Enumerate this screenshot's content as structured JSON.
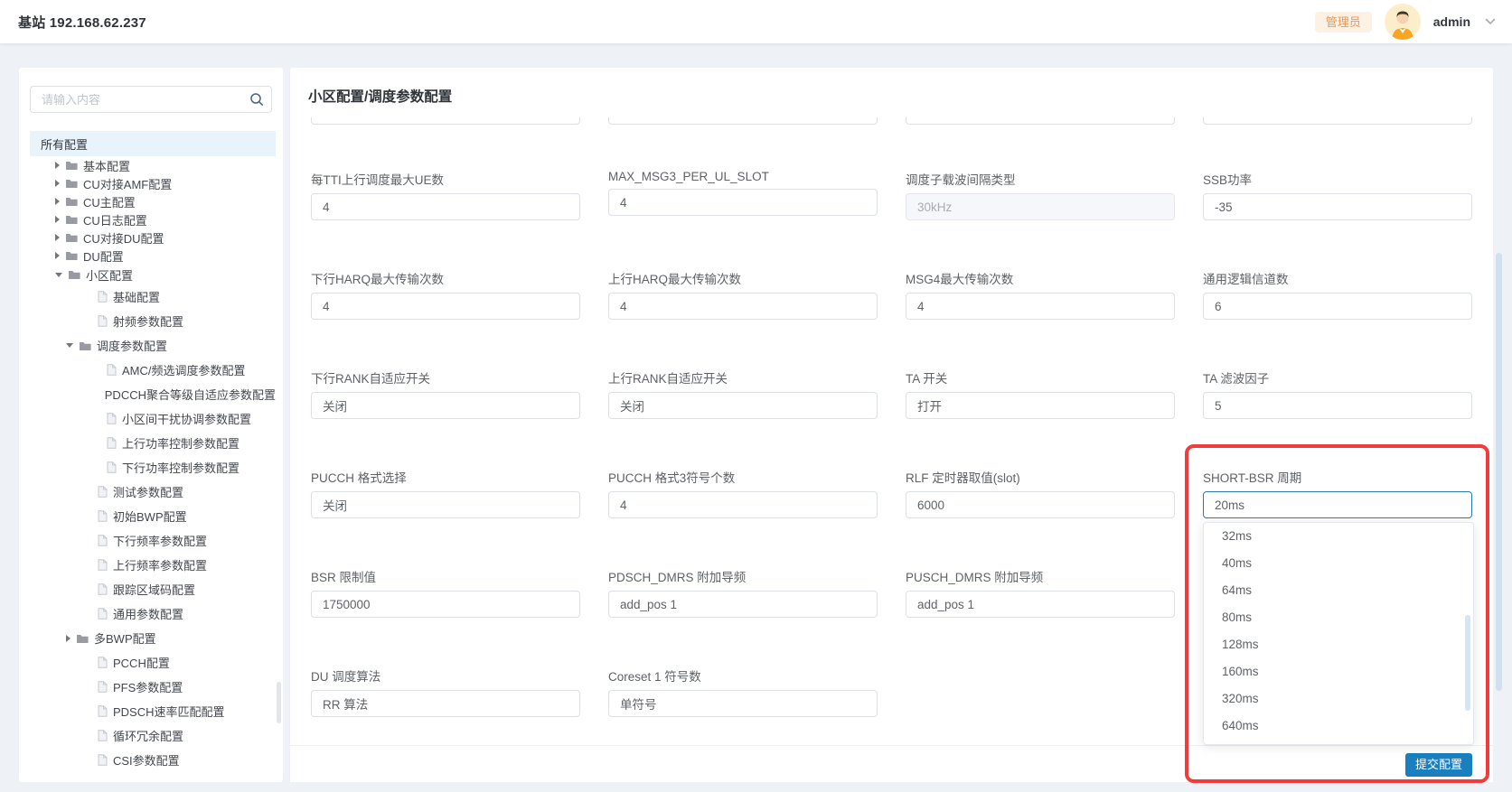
{
  "colors": {
    "accent_red": "#f23c3c",
    "submit_blue": "#1a7fbf",
    "badge_text": "#ef9454",
    "badge_bg": "#fdf1e3",
    "focus_border": "#2a7ab2",
    "disabled_bg": "#f5f7fa"
  },
  "header": {
    "station_title": "基站 192.168.62.237",
    "role_badge": "管理员",
    "username": "admin"
  },
  "sidebar": {
    "search_placeholder": "请输入内容",
    "root_label": "所有配置",
    "tree": [
      {
        "label": "基本配置",
        "level": 1,
        "icon": "folder",
        "caret": "right"
      },
      {
        "label": "CU对接AMF配置",
        "level": 1,
        "icon": "folder",
        "caret": "right"
      },
      {
        "label": "CU主配置",
        "level": 1,
        "icon": "folder",
        "caret": "right"
      },
      {
        "label": "CU日志配置",
        "level": 1,
        "icon": "folder",
        "caret": "right"
      },
      {
        "label": "CU对接DU配置",
        "level": 1,
        "icon": "folder",
        "caret": "right"
      },
      {
        "label": "DU配置",
        "level": 1,
        "icon": "folder",
        "caret": "right"
      },
      {
        "label": "小区配置",
        "level": 1,
        "icon": "folder",
        "caret": "down"
      },
      {
        "label": "基础配置",
        "level": 2,
        "icon": "file"
      },
      {
        "label": "射频参数配置",
        "level": 2,
        "icon": "file"
      },
      {
        "label": "调度参数配置",
        "level": 2,
        "icon": "folder",
        "caret": "down"
      },
      {
        "label": "AMC/频选调度参数配置",
        "level": 3,
        "icon": "file"
      },
      {
        "label": "PDCCH聚合等级自适应参数配置",
        "level": 3,
        "icon": "file"
      },
      {
        "label": "小区间干扰协调参数配置",
        "level": 3,
        "icon": "file"
      },
      {
        "label": "上行功率控制参数配置",
        "level": 3,
        "icon": "file"
      },
      {
        "label": "下行功率控制参数配置",
        "level": 3,
        "icon": "file"
      },
      {
        "label": "测试参数配置",
        "level": 2,
        "icon": "file"
      },
      {
        "label": "初始BWP配置",
        "level": 2,
        "icon": "file"
      },
      {
        "label": "下行频率参数配置",
        "level": 2,
        "icon": "file"
      },
      {
        "label": "上行频率参数配置",
        "level": 2,
        "icon": "file"
      },
      {
        "label": "跟踪区域码配置",
        "level": 2,
        "icon": "file"
      },
      {
        "label": "通用参数配置",
        "level": 2,
        "icon": "file"
      },
      {
        "label": "多BWP配置",
        "level": 2,
        "icon": "folder",
        "caret": "right"
      },
      {
        "label": "PCCH配置",
        "level": 2,
        "icon": "file"
      },
      {
        "label": "PFS参数配置",
        "level": 2,
        "icon": "file"
      },
      {
        "label": "PDSCH速率匹配配置",
        "level": 2,
        "icon": "file"
      },
      {
        "label": "循环冗余配置",
        "level": 2,
        "icon": "file"
      },
      {
        "label": "CSI参数配置",
        "level": 2,
        "icon": "file"
      }
    ]
  },
  "main": {
    "title": "小区配置/调度参数配置",
    "submit_label": "提交配置",
    "rows": [
      {
        "fields": [
          {
            "key": "ue-max-per-tti",
            "label": "每TTI上行调度最大UE数",
            "value": "4"
          },
          {
            "key": "max-msg3",
            "label": "MAX_MSG3_PER_UL_SLOT",
            "value": "4"
          },
          {
            "key": "scs-type",
            "label": "调度子载波间隔类型",
            "value": "30kHz",
            "state": "disabled"
          },
          {
            "key": "ssb-power",
            "label": "SSB功率",
            "value": "-35"
          }
        ]
      },
      {
        "fields": [
          {
            "key": "dl-harq-max",
            "label": "下行HARQ最大传输次数",
            "value": "4"
          },
          {
            "key": "ul-harq-max",
            "label": "上行HARQ最大传输次数",
            "value": "4"
          },
          {
            "key": "msg4-max",
            "label": "MSG4最大传输次数",
            "value": "4"
          },
          {
            "key": "logic-channels",
            "label": "通用逻辑信道数",
            "value": "6"
          }
        ]
      },
      {
        "fields": [
          {
            "key": "dl-rank-adapt",
            "label": "下行RANK自适应开关",
            "value": "关闭"
          },
          {
            "key": "ul-rank-adapt",
            "label": "上行RANK自适应开关",
            "value": "关闭"
          },
          {
            "key": "ta-switch",
            "label": "TA 开关",
            "value": "打开"
          },
          {
            "key": "ta-filter",
            "label": "TA 滤波因子",
            "value": "5"
          }
        ]
      },
      {
        "fields": [
          {
            "key": "pucch-format",
            "label": "PUCCH 格式选择",
            "value": "关闭"
          },
          {
            "key": "pucch-fmt3-sym",
            "label": "PUCCH 格式3符号个数",
            "value": "4"
          },
          {
            "key": "rlf-timer",
            "label": "RLF 定时器取值(slot)",
            "value": "6000"
          },
          {
            "key": "short-bsr-period",
            "label": "SHORT-BSR 周期",
            "value": "20ms",
            "state": "focused"
          }
        ]
      },
      {
        "fields": [
          {
            "key": "bsr-limit",
            "label": "BSR 限制值",
            "value": "1750000"
          },
          {
            "key": "pdsch-dmrs",
            "label": "PDSCH_DMRS 附加导频",
            "value": "add_pos 1"
          },
          {
            "key": "pusch-dmrs",
            "label": "PUSCH_DMRS 附加导频",
            "value": "add_pos 1"
          }
        ]
      },
      {
        "fields": [
          {
            "key": "du-sched-algo",
            "label": "DU 调度算法",
            "value": "RR 算法"
          },
          {
            "key": "coreset1-sym",
            "label": "Coreset 1 符号数",
            "value": "单符号"
          }
        ]
      }
    ]
  },
  "dropdown": {
    "selected": "20ms",
    "options": [
      "32ms",
      "40ms",
      "64ms",
      "80ms",
      "128ms",
      "160ms",
      "320ms",
      "640ms"
    ]
  }
}
